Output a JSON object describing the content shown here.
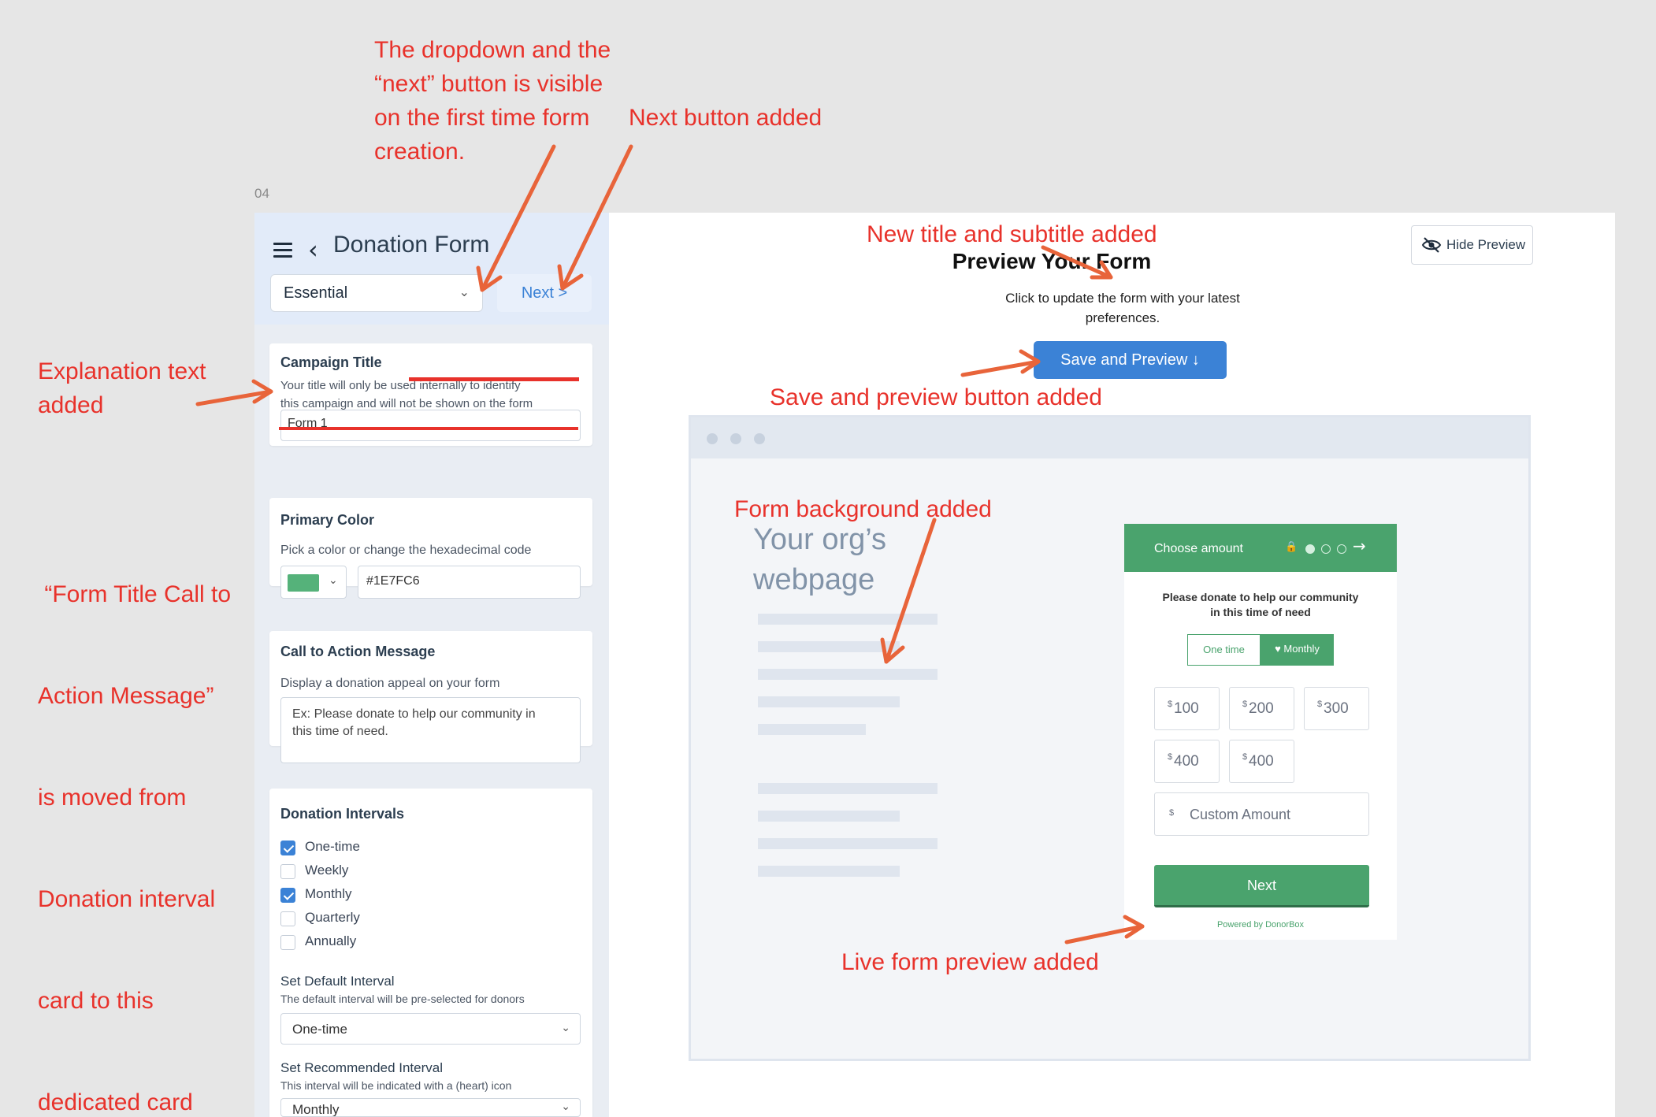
{
  "frame_label": "04",
  "panel": {
    "title": "Donation Form",
    "preset_select": "Essential",
    "next_label": "Next >",
    "campaign": {
      "title": "Campaign Title",
      "explanation_line1": "Your title will only be used internally to identify",
      "explanation_line2": "this campaign and will not be shown on the form",
      "value": "Form 1"
    },
    "primary_color": {
      "title": "Primary Color",
      "subtitle": "Pick a color or change the hexadecimal code",
      "swatch": "#55b27a",
      "hex_value": "#1E7FC6"
    },
    "cta": {
      "title": "Call to Action Message",
      "subtitle": "Display a donation appeal on your form",
      "placeholder_line1": "Ex: Please donate to help our community in",
      "placeholder_line2": "this time of need."
    },
    "intervals": {
      "title": "Donation Intervals",
      "options": [
        {
          "label": "One-time",
          "checked": true
        },
        {
          "label": "Weekly",
          "checked": false
        },
        {
          "label": "Monthly",
          "checked": true
        },
        {
          "label": "Quarterly",
          "checked": false
        },
        {
          "label": "Annually",
          "checked": false
        }
      ],
      "default_title": "Set Default Interval",
      "default_desc": "The default interval will be pre-selected for donors",
      "default_value": "One-time",
      "recommended_title": "Set Recommended Interval",
      "recommended_desc": "This interval will be indicated with a (heart) icon",
      "recommended_value": "Monthly"
    }
  },
  "preview": {
    "hide_label": "Hide Preview",
    "title": "Preview Your Form",
    "subtitle": "Click to update the form with your latest preferences.",
    "save_label": "Save and Preview ↓",
    "org_line1": "Your org’s",
    "org_line2": "webpage",
    "donor_form": {
      "header": "Choose amount",
      "appeal_line1": "Please donate to help our community",
      "appeal_line2": "in this time of need",
      "one_time": "One time",
      "monthly": "♥ Monthly",
      "currency": "$",
      "amounts": [
        "100",
        "200",
        "300",
        "400",
        "400"
      ],
      "custom_placeholder": "Custom Amount",
      "next_label": "Next",
      "powered": "Powered by DonorBox"
    }
  },
  "annotations": {
    "dropdown_note": [
      "The dropdown and the",
      "“next” button is visible",
      "on the first time form",
      "creation."
    ],
    "next_note": "Next button added",
    "explanation_note": [
      "Explanation text",
      "added"
    ],
    "form_title_note": [
      " “Form Title Call to",
      "Action Message”",
      "is moved from",
      "Donation interval",
      "card to this",
      "dedicated card"
    ],
    "new_title_note": "New title and subtitle added",
    "save_note": "Save and  preview button added",
    "background_note": "Form background added",
    "live_note": "Live form preview added",
    "arrow_color": "#e8643a",
    "text_color": "#e8322b"
  }
}
